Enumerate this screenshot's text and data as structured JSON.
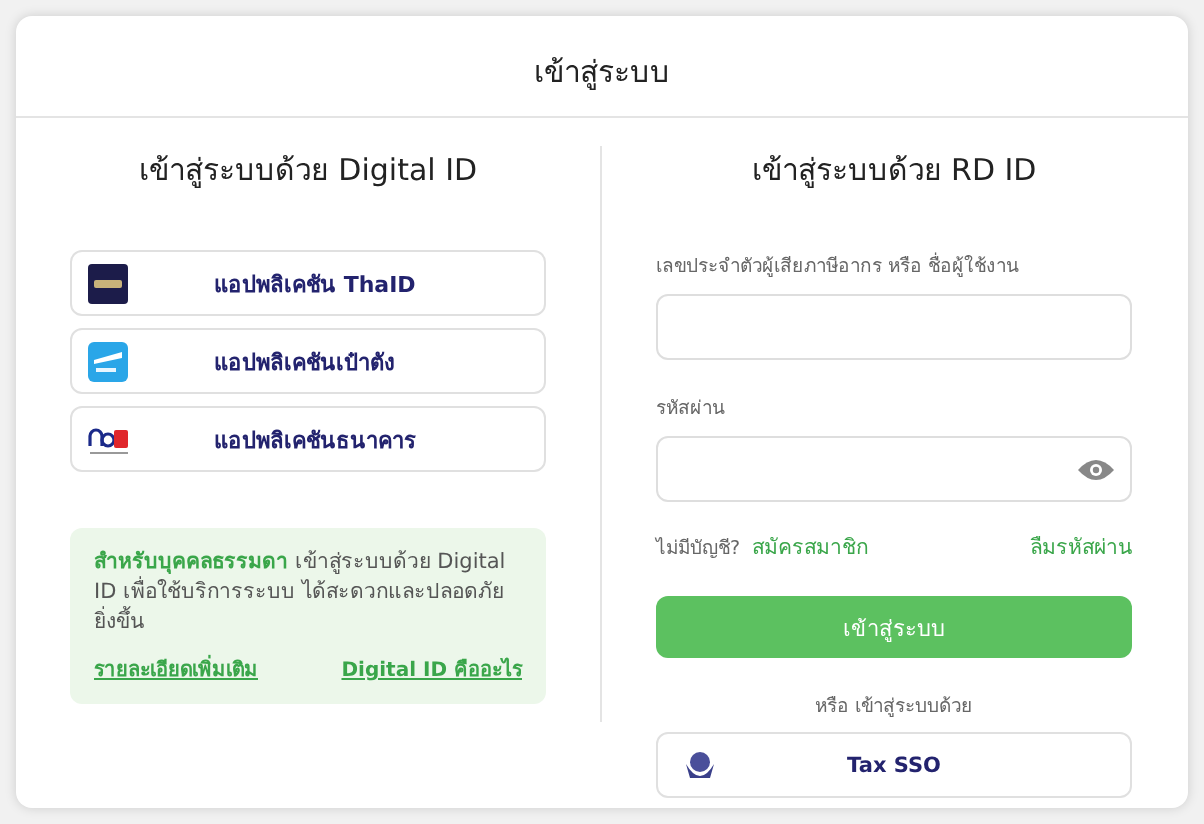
{
  "title": "เข้าสู่ระบบ",
  "digital_id": {
    "heading": "เข้าสู่ระบบด้วย Digital ID",
    "apps": [
      {
        "kind": "thaid",
        "label": "แอปพลิเคชัน ThaID"
      },
      {
        "kind": "paotang",
        "label": "แอปพลิเคชันเป๋าตัง"
      },
      {
        "kind": "ndid",
        "label": "แอปพลิเคชันธนาคาร"
      }
    ],
    "notice": {
      "text": "**สำหรับบุคคลธรรมดา** เข้าสู่ระบบด้วย Digital ID เพื่อใช้บริการระบบ ได้สะดวกและปลอดภัยยิ่งขึ้น",
      "links": [
        "รายละเอียดเพิ่มเติม",
        "Digital ID คืออะไร"
      ]
    }
  },
  "rd_id": {
    "heading": "เข้าสู่ระบบด้วย RD ID",
    "username_label": "เลขประจำตัวผู้เสียภาษีอากร หรือ ชื่อผู้ใช้งาน",
    "password_label": "รหัสผ่าน",
    "no_account": "ไม่มีบัญชี?",
    "register": "สมัครสมาชิก",
    "forgot": "ลืมรหัสผ่าน",
    "login_button": "เข้าสู่ระบบ",
    "alt_label": "หรือ เข้าสู่ระบบด้วย",
    "sso_button": "Tax SSO"
  }
}
